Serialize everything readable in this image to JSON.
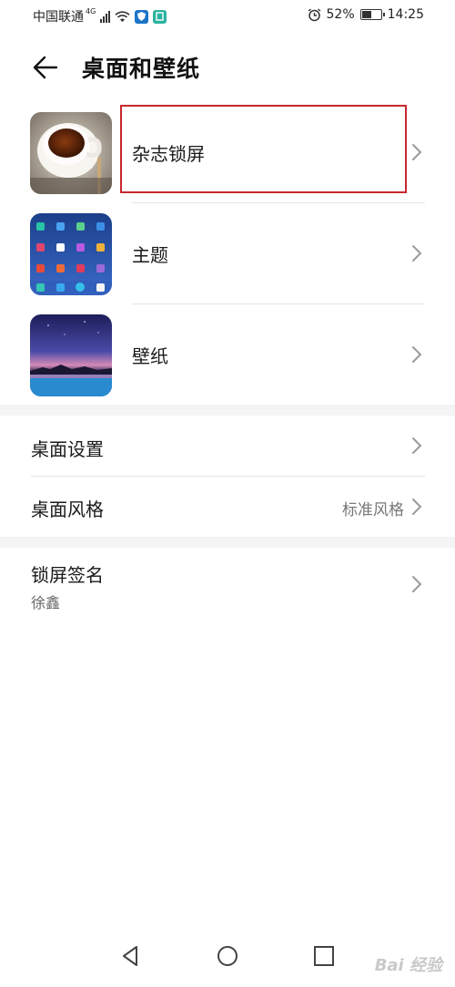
{
  "status_bar": {
    "carrier": "中国联通",
    "network": "4G",
    "battery_percent": "52%",
    "battery_level": 0.52,
    "time": "14:25",
    "icons": [
      "signal-icon",
      "wifi-icon",
      "shield-app-icon",
      "app-badge-icon",
      "alarm-icon",
      "battery-icon"
    ]
  },
  "header": {
    "title": "桌面和壁纸",
    "back_icon": "back-arrow-icon"
  },
  "thumb_items": [
    {
      "label": "杂志锁屏",
      "icon": "magazine-lockscreen-thumbnail",
      "highlighted": true
    },
    {
      "label": "主题",
      "icon": "theme-thumbnail"
    },
    {
      "label": "壁纸",
      "icon": "wallpaper-thumbnail"
    }
  ],
  "desktop_settings": {
    "label": "桌面设置"
  },
  "desktop_style": {
    "label": "桌面风格",
    "value": "标准风格"
  },
  "lockscreen_signature": {
    "label": "锁屏签名",
    "value": "徐鑫"
  },
  "nav": {
    "icons": [
      "nav-back-icon",
      "nav-home-icon",
      "nav-recents-icon"
    ]
  },
  "watermark": "Bai 经验",
  "colors": {
    "highlight": "#c8282e",
    "divider": "#e3e3e3",
    "section_bg": "#f4f4f4"
  }
}
